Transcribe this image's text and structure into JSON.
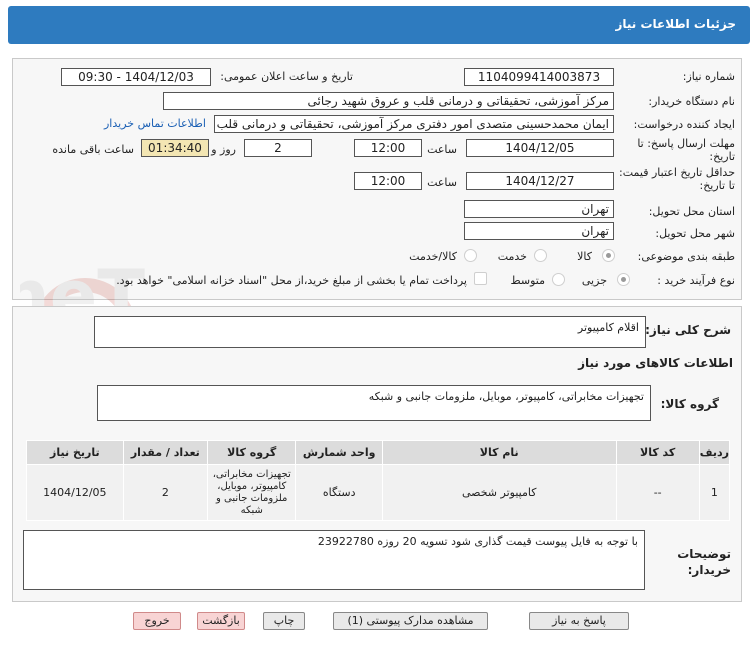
{
  "header": {
    "title": "جزئیات اطلاعات نیاز"
  },
  "form": {
    "need_number_label": "شماره نیاز:",
    "need_number": "1104099414003873",
    "announce_label": "تاریخ و ساعت اعلان عمومی:",
    "announce_value": "1404/12/03 - 09:30",
    "buyer_label": "نام دستگاه خریدار:",
    "buyer_value": "مرکز آموزشی، تحقیقاتی و درمانی قلب و عروق شهید رجائی",
    "creator_label": "ایجاد کننده درخواست:",
    "creator_value": "ایمان محمدحسینی متصدی امور دفتری مرکز آموزشی، تحقیقاتی و درمانی قلب",
    "contact_link": "اطلاعات تماس خریدار",
    "deadline_label": "مهلت ارسال پاسخ: تا تاریخ:",
    "deadline_date": "1404/12/05",
    "deadline_time_label": "ساعت",
    "deadline_time": "12:00",
    "days_value": "2",
    "days_label": "روز و",
    "remaining_time": "01:34:40",
    "remaining_label": "ساعت باقی مانده",
    "validity_label": "حداقل تاریخ اعتبار قیمت: تا تاریخ:",
    "validity_date": "1404/12/27",
    "validity_time_label": "ساعت",
    "validity_time": "12:00",
    "province_label": "استان محل تحویل:",
    "province_value": "تهران",
    "city_label": "شهر محل تحویل:",
    "city_value": "تهران",
    "category_label": "طبقه بندی موضوعی:",
    "category_options": [
      "کالا",
      "خدمت",
      "کالا/خدمت"
    ],
    "process_label": "نوع فرآیند خرید :",
    "process_options": [
      "جزیی",
      "متوسط"
    ],
    "payment_note": "پرداخت تمام یا بخشی از مبلغ خرید،از محل \"اسناد خزانه اسلامی\" خواهد بود."
  },
  "summary": {
    "desc_label": "شرح کلی نیاز:",
    "desc_value": "اقلام کامپیوتر",
    "goods_info_label": "اطلاعات کالاهای مورد نیاز",
    "group_label": "گروه کالا:",
    "group_value": "تجهیزات مخابراتی، کامپیوتر، موبایل، ملزومات جانبی و شبکه"
  },
  "table": {
    "headers": [
      "ردیف",
      "کد کالا",
      "نام کالا",
      "واحد شمارش",
      "گروه کالا",
      "تعداد / مقدار",
      "تاریخ نیاز"
    ],
    "rows": [
      {
        "row": "1",
        "code": "--",
        "name": "کامپیوتر شخصی",
        "unit": "دستگاه",
        "group": "تجهیزات مخابراتی، کامپیوتر، موبایل، ملزومات جانبی و شبکه",
        "qty": "2",
        "date": "1404/12/05"
      }
    ]
  },
  "buyer_notes": {
    "label": "توضیحات خریدار:",
    "value": "با توجه به فایل پیوست قیمت گذاری شود تسویه 20 روزه 23922780"
  },
  "buttons": {
    "reply": "پاسخ به نیاز",
    "attachments": "مشاهده مدارک پیوستی (1)",
    "print": "چاپ",
    "back": "بازگشت",
    "exit": "خروج"
  },
  "watermark": {
    "text": "AriaTender.neT"
  }
}
